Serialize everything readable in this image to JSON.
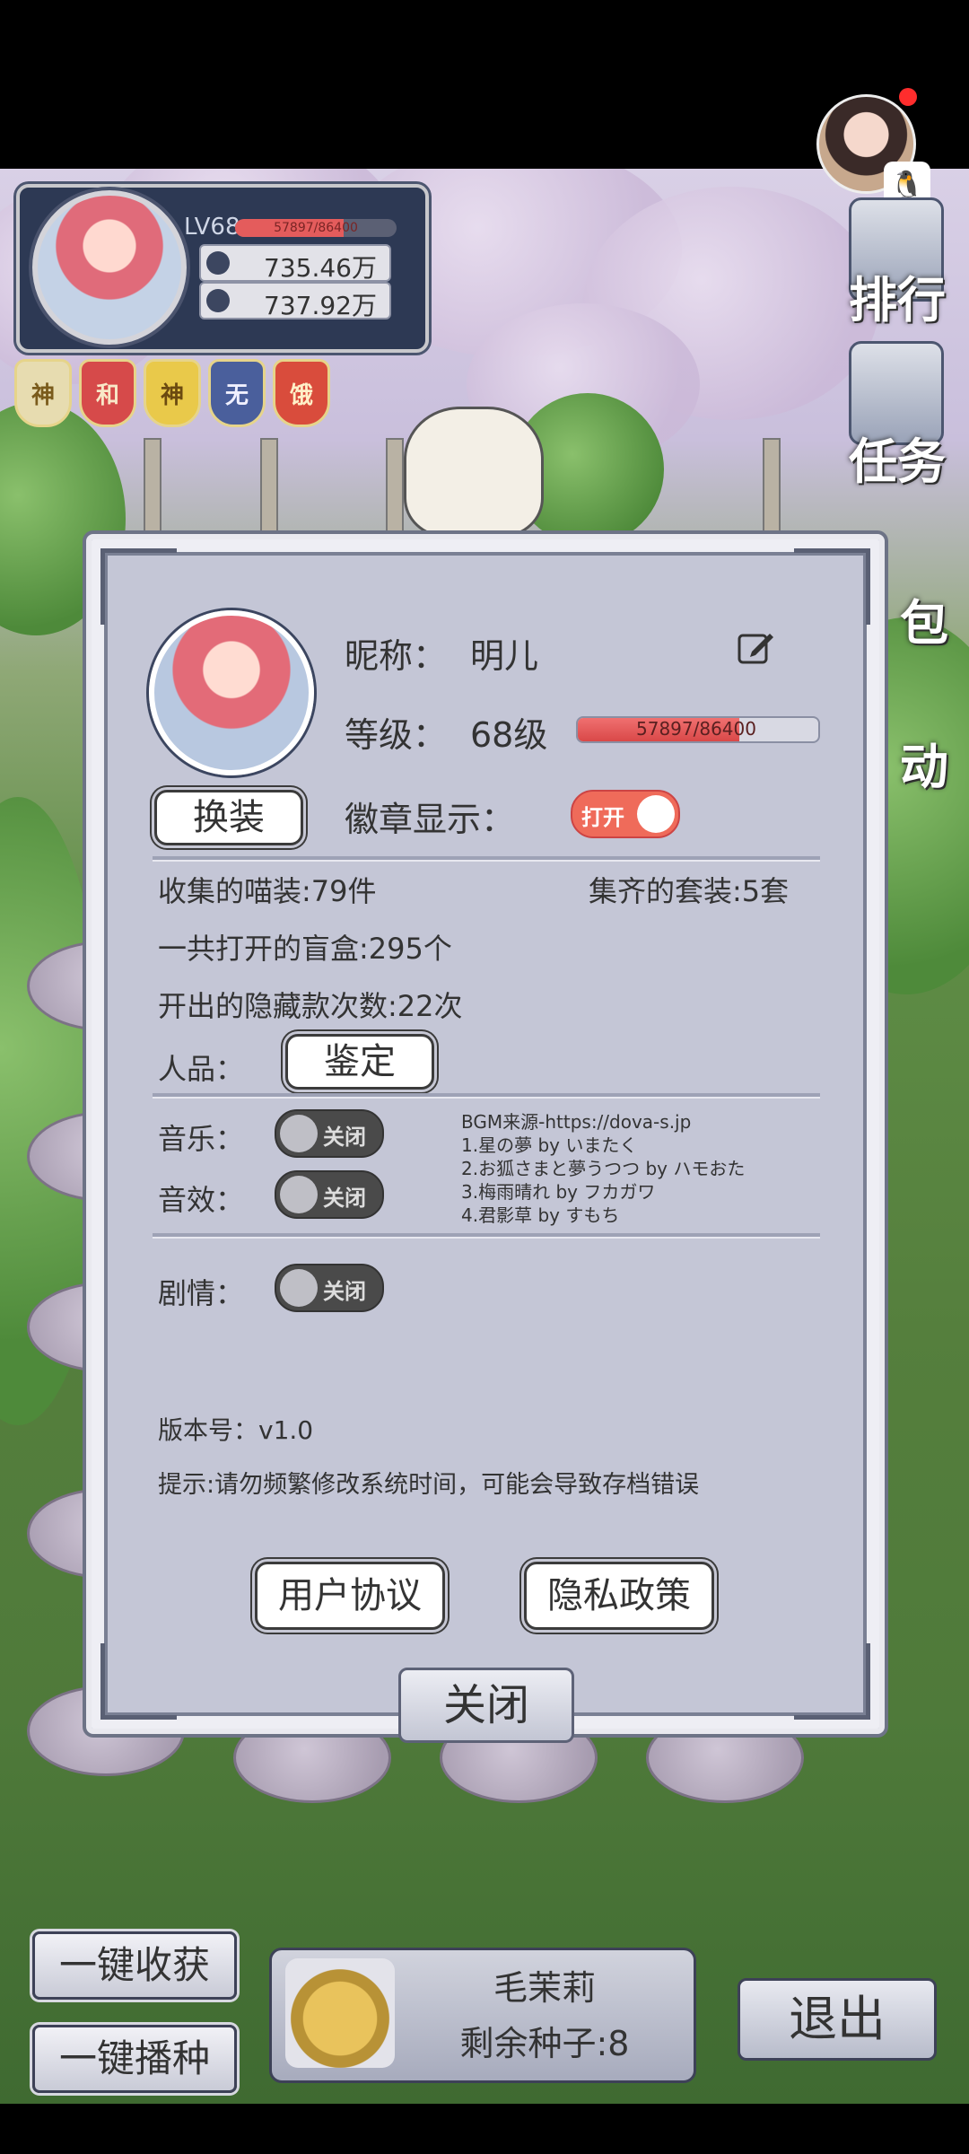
{
  "player": {
    "level": "LV68",
    "xp": "57897/86400",
    "xp_fraction": 0.67,
    "resource1": "735.46万",
    "resource2": "737.92万"
  },
  "badges": [
    {
      "char": "神",
      "bg": "#e7dcb0",
      "color": "#7a5b1c"
    },
    {
      "char": "和",
      "bg": "#d64a4a",
      "color": "#f8e8c8"
    },
    {
      "char": "神",
      "bg": "#e9c94a",
      "color": "#6b4a10"
    },
    {
      "char": "无",
      "bg": "#4a5f9c",
      "color": "#f0f0ff"
    },
    {
      "char": "饿",
      "bg": "#d94c3c",
      "color": "#fff0c8"
    }
  ],
  "side_menu": {
    "rank": "排行",
    "task": "任务",
    "bag": "包",
    "event": "动"
  },
  "dialog": {
    "nickname_label": "昵称：",
    "nickname": "明儿",
    "level_label": "等级：",
    "level": "68级",
    "xp_text": "57897/86400",
    "xp_fraction": 0.67,
    "outfit_button": "换装",
    "badge_display_label": "徽章显示：",
    "badge_toggle": "打开",
    "collected_outfits": "收集的喵装:79件",
    "complete_sets": "集齐的套装:5套",
    "blind_boxes": "一共打开的盲盒:295个",
    "hidden_count": "开出的隐藏款次数:22次",
    "character_label": "人品：",
    "appraise_button": "鉴定",
    "music_label": "音乐：",
    "sfx_label": "音效：",
    "story_label": "剧情：",
    "off_label": "关闭",
    "bgm_lines": [
      "BGM来源-https://dova-s.jp",
      "1.星の夢 by いまたく",
      "2.お狐さまと夢うつつ by ハモおた",
      "3.梅雨晴れ by フカガワ",
      "4.君影草 by すもち"
    ],
    "version": "版本号：v1.0",
    "tip": "提示:请勿频繁修改系统时间，可能会导致存档错误",
    "user_agreement": "用户协议",
    "privacy_policy": "隐私政策",
    "close": "关闭"
  },
  "bottom": {
    "harvest_all": "一键收获",
    "sow_all": "一键播种",
    "seed_name": "毛茉莉",
    "seeds_left": "剩余种子:8",
    "exit": "退出"
  },
  "colors": {
    "dialog_bg": "#c4c6d6",
    "toggle_on": "#ef6b5a",
    "xp_fill": "#d94848"
  }
}
